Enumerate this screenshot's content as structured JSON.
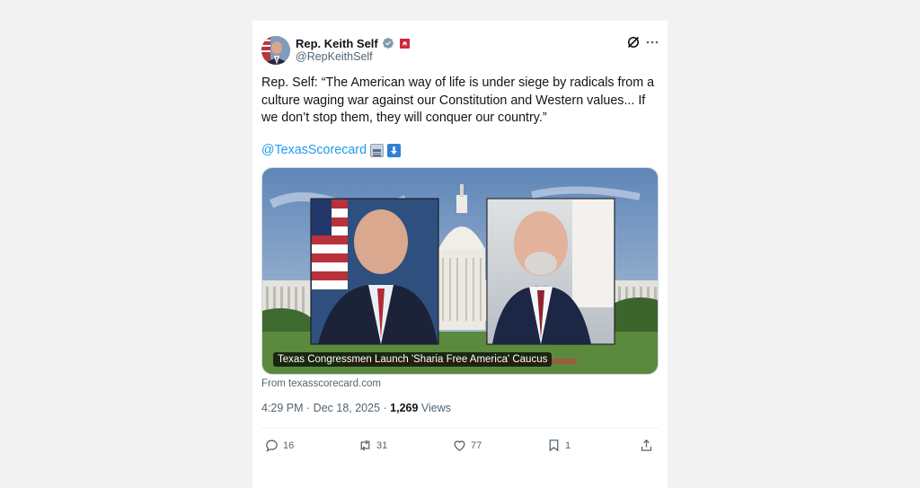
{
  "author": {
    "display_name": "Rep. Keith Self",
    "handle": "@RepKeithSelf"
  },
  "tweet": {
    "text": "Rep. Self: “The American way of life is under siege by radicals from a culture waging war against our Constitution and Western values... If we don’t stop them, they will conquer our country.”",
    "mention": "@TexasScorecard",
    "emojis": [
      "newspaper-emoji",
      "down-arrow-emoji"
    ]
  },
  "media": {
    "caption": "Texas Congressmen Launch 'Sharia Free America' Caucus",
    "source": "From texasscorecard.com"
  },
  "meta": {
    "time": "4:29 PM",
    "separator": " · ",
    "date": "Dec 18, 2025",
    "views_count": "1,269",
    "views_label": " Views"
  },
  "actions": {
    "replies": "16",
    "reposts": "31",
    "likes": "77",
    "bookmarks": "1"
  },
  "colors": {
    "link": "#1d9bf0",
    "muted": "#536471",
    "background": "#f2f2f2",
    "affiliation_badge": "#d0263c"
  },
  "icons": [
    "grok-icon",
    "more-icon",
    "verified-icon",
    "reply-icon",
    "repost-icon",
    "like-icon",
    "bookmark-icon",
    "share-icon"
  ]
}
